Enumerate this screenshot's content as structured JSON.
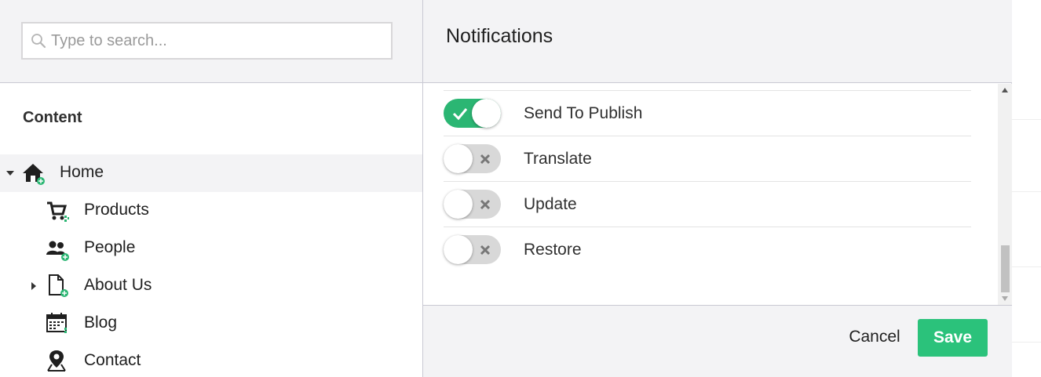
{
  "search": {
    "placeholder": "Type to search..."
  },
  "content": {
    "section_title": "Content",
    "tree": [
      {
        "label": "Home",
        "icon": "home-icon",
        "selected": true,
        "expanded": true
      },
      {
        "label": "Products",
        "icon": "shopping-cart-icon"
      },
      {
        "label": "People",
        "icon": "people-icon"
      },
      {
        "label": "About Us",
        "icon": "document-icon",
        "expanded": false
      },
      {
        "label": "Blog",
        "icon": "calendar-icon"
      },
      {
        "label": "Contact",
        "icon": "map-pin-icon"
      }
    ]
  },
  "dialog": {
    "title": "Notifications",
    "notifications": [
      {
        "label": "Send To Publish",
        "enabled": true
      },
      {
        "label": "Translate",
        "enabled": false
      },
      {
        "label": "Update",
        "enabled": false
      },
      {
        "label": "Restore",
        "enabled": false
      }
    ],
    "cancel_label": "Cancel",
    "save_label": "Save"
  },
  "colors": {
    "accent_green": "#2bb673",
    "save_green": "#2bc27b",
    "header_bg": "#f3f3f5",
    "toggle_off": "#d8d8d8"
  }
}
